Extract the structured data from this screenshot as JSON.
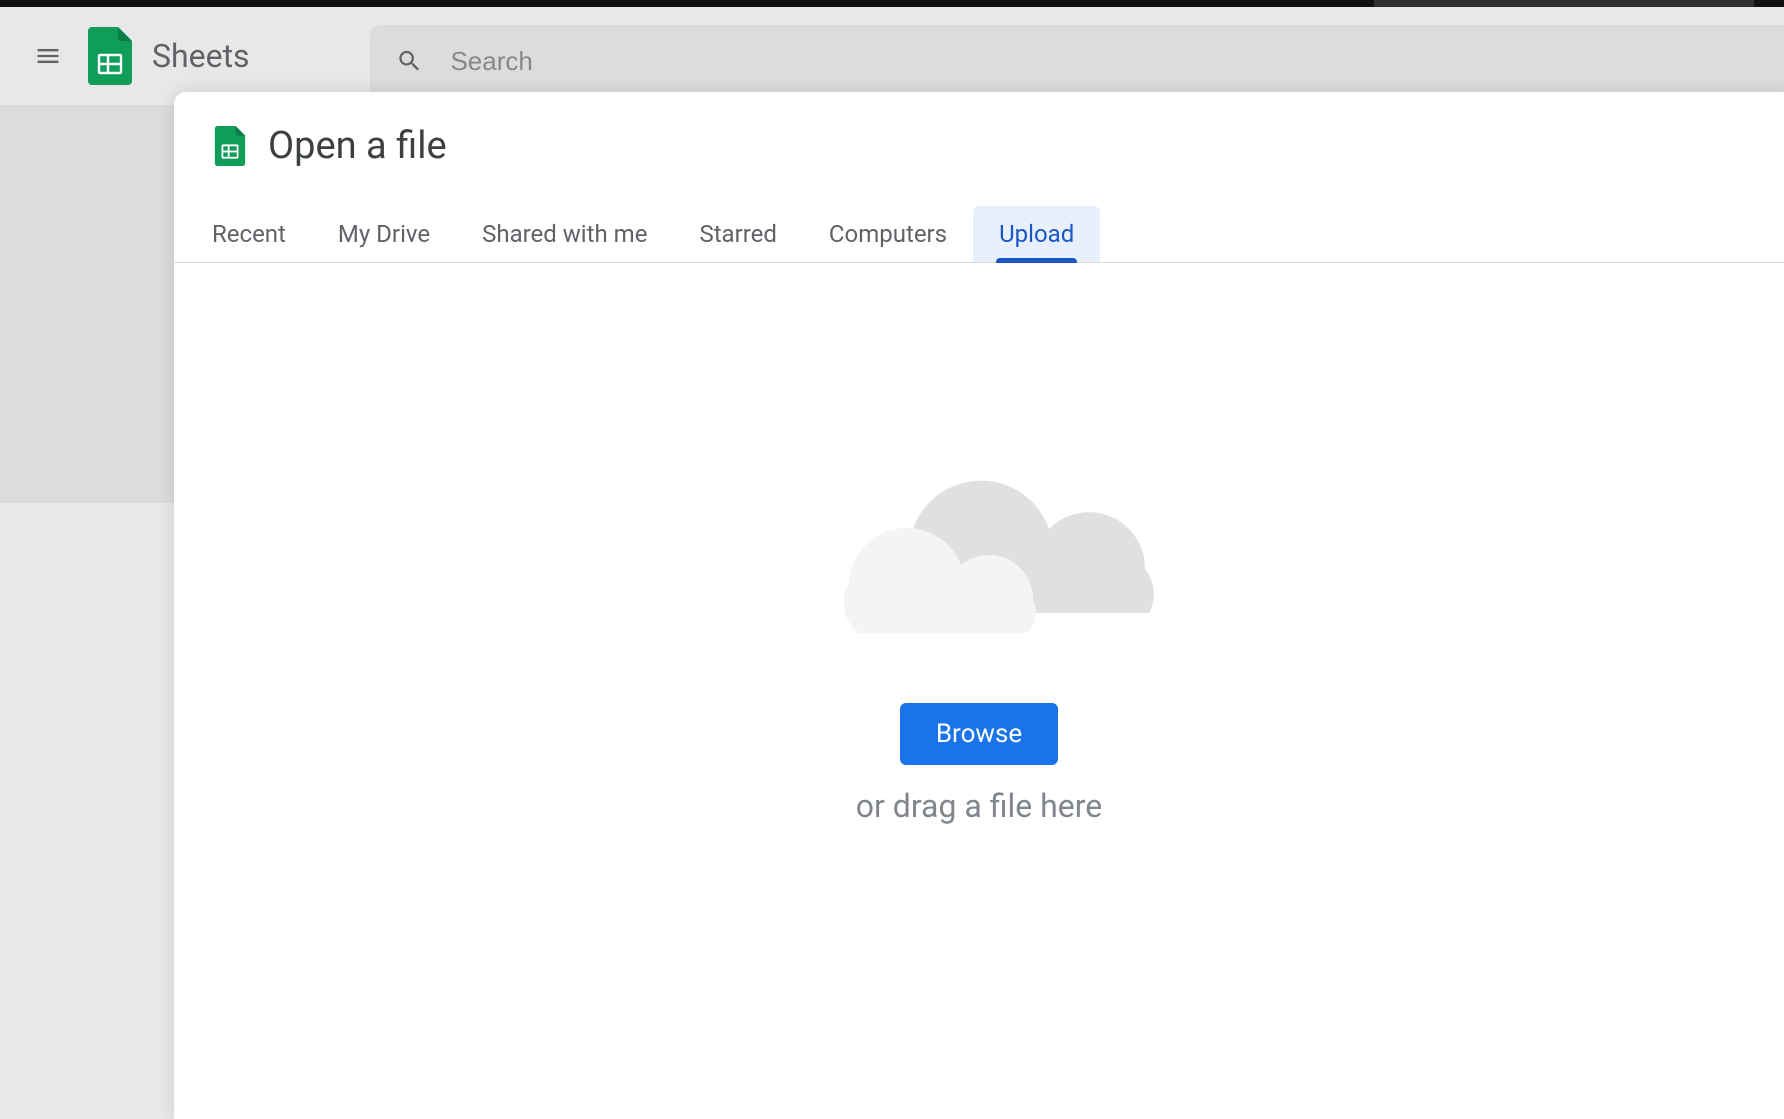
{
  "header": {
    "app_title": "Sheets",
    "search_placeholder": "Search"
  },
  "dialog": {
    "title": "Open a file",
    "tabs": [
      {
        "label": "Recent"
      },
      {
        "label": "My Drive"
      },
      {
        "label": "Shared with me"
      },
      {
        "label": "Starred"
      },
      {
        "label": "Computers"
      },
      {
        "label": "Upload"
      }
    ],
    "active_tab_index": 5,
    "upload": {
      "browse_label": "Browse",
      "drag_hint": "or drag a file here"
    }
  },
  "colors": {
    "brand_green": "#0f9d58",
    "accent_blue": "#1a73e8",
    "tab_active_bg": "#e8f0fe",
    "tab_active_fg": "#1a56c4"
  }
}
